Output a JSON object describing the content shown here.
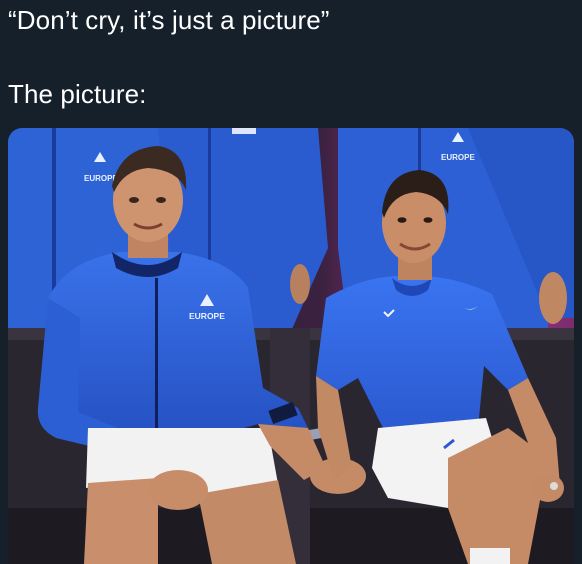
{
  "post": {
    "quote_line": "“Don’t cry, it’s just a picture”",
    "label_line": "The picture:"
  },
  "photo": {
    "jacket_logo_text": "EUROPE",
    "colors": {
      "background": "#15202b",
      "jacket_blue": "#2f63d9",
      "jacket_dark": "#1a3a9c",
      "stage_magenta": "#b03a8e",
      "bench": "#2a2630",
      "shorts_white": "#f2f2f2",
      "skin": "#c98f6c"
    }
  }
}
